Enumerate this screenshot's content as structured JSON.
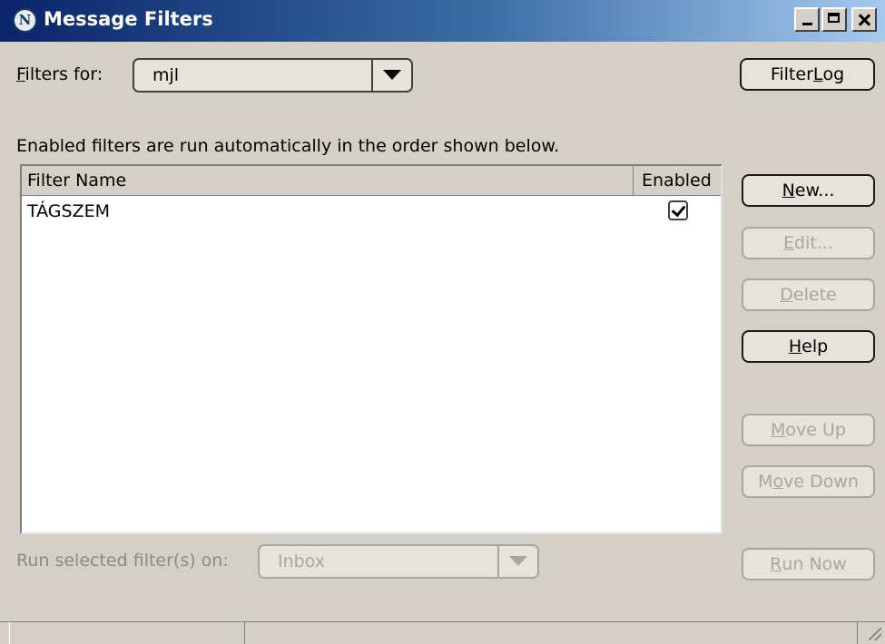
{
  "window": {
    "title": "Message Filters",
    "controls": [
      "minimize",
      "maximize",
      "close"
    ]
  },
  "filters_for": {
    "label_prefix": "",
    "label_mnemonic": "F",
    "label_rest": "ilters for:",
    "selected": "mjl"
  },
  "filter_log_button": {
    "prefix": "Filter ",
    "mnemonic": "L",
    "rest": "og"
  },
  "description": "Enabled filters are run automatically in the order shown below.",
  "table": {
    "columns": [
      "Filter Name",
      "Enabled"
    ],
    "rows": [
      {
        "name": "TÁGSZEM",
        "enabled": true
      }
    ]
  },
  "buttons": {
    "new": {
      "mnemonic": "N",
      "rest": "ew...",
      "enabled": true
    },
    "edit": {
      "mnemonic": "E",
      "rest": "dit...",
      "enabled": false
    },
    "delete": {
      "mnemonic": "D",
      "rest": "elete",
      "enabled": false
    },
    "help": {
      "mnemonic": "H",
      "rest": "elp",
      "enabled": true
    },
    "move_up": {
      "mnemonic": "M",
      "rest": "ove Up",
      "enabled": false
    },
    "move_down": {
      "prefix": "M",
      "mnemonic": "o",
      "rest": "ve Down",
      "enabled": false
    },
    "run_now": {
      "mnemonic": "R",
      "rest": "un Now",
      "enabled": false
    }
  },
  "run_on": {
    "label_prefix": "Run selected f",
    "label_mnemonic": "i",
    "label_rest": "lter(s) on:",
    "selected": "Inbox",
    "enabled": false
  },
  "icons": {
    "app": "app-logo-icon",
    "dropdown": "chevron-down-icon",
    "check": "checkbox-checked-icon",
    "resize": "resize-grip-icon"
  }
}
